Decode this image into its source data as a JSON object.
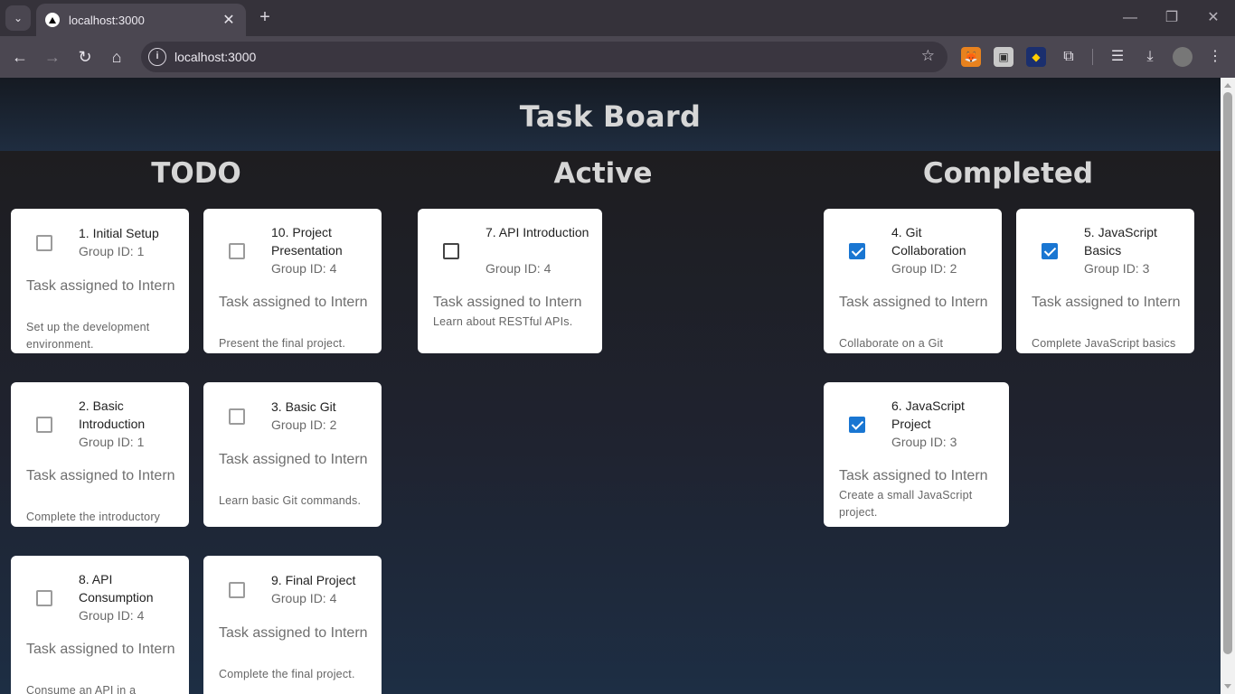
{
  "browser": {
    "tab_title": "localhost:3000",
    "url": "localhost:3000",
    "new_tab": "+",
    "close_tab": "✕",
    "window_controls": {
      "minimize": "—",
      "maximize": "❐",
      "close": "✕"
    }
  },
  "page": {
    "title": "Task Board",
    "columns": {
      "todo": "TODO",
      "active": "Active",
      "completed": "Completed"
    }
  },
  "cards": {
    "c1": {
      "title": "1. Initial Setup",
      "group": "Group ID: 1",
      "assign": "Task assigned to Intern",
      "desc": "Set up the development environment.",
      "checked": false
    },
    "c10": {
      "title": "10. Project Presentation",
      "group": "Group ID: 4",
      "assign": "Task assigned to Intern",
      "desc": "Present the final project.",
      "checked": false
    },
    "c7": {
      "title": "7. API Introduction",
      "group": "Group ID: 4",
      "assign": "Task assigned to Intern",
      "desc": "Learn about RESTful APIs.",
      "checked": false
    },
    "c4": {
      "title": "4. Git Collaboration",
      "group": "Group ID: 2",
      "assign": "Task assigned to Intern",
      "desc": "Collaborate on a Git",
      "checked": true
    },
    "c5": {
      "title": "5. JavaScript Basics",
      "group": "Group ID: 3",
      "assign": "Task assigned to Intern",
      "desc": "Complete JavaScript basics",
      "checked": true
    },
    "c2": {
      "title": "2. Basic Introduction",
      "group": "Group ID: 1",
      "assign": "Task assigned to Intern",
      "desc": "Complete the introductory",
      "checked": false
    },
    "c3": {
      "title": "3. Basic Git",
      "group": "Group ID: 2",
      "assign": "Task assigned to Intern",
      "desc": "Learn basic Git commands.",
      "checked": false
    },
    "c6": {
      "title": "6. JavaScript Project",
      "group": "Group ID: 3",
      "assign": "Task assigned to Intern",
      "desc": "Create a small JavaScript project.",
      "checked": true
    },
    "c8": {
      "title": "8. API Consumption",
      "group": "Group ID: 4",
      "assign": "Task assigned to Intern",
      "desc": "Consume an API in a",
      "checked": false
    },
    "c9": {
      "title": "9. Final Project",
      "group": "Group ID: 4",
      "assign": "Task assigned to Intern",
      "desc": "Complete the final project.",
      "checked": false
    }
  },
  "colors": {
    "checkbox_checked": "#1976d2",
    "header_gradient_top": "#151a22",
    "header_gradient_bottom": "#1f2d40"
  }
}
